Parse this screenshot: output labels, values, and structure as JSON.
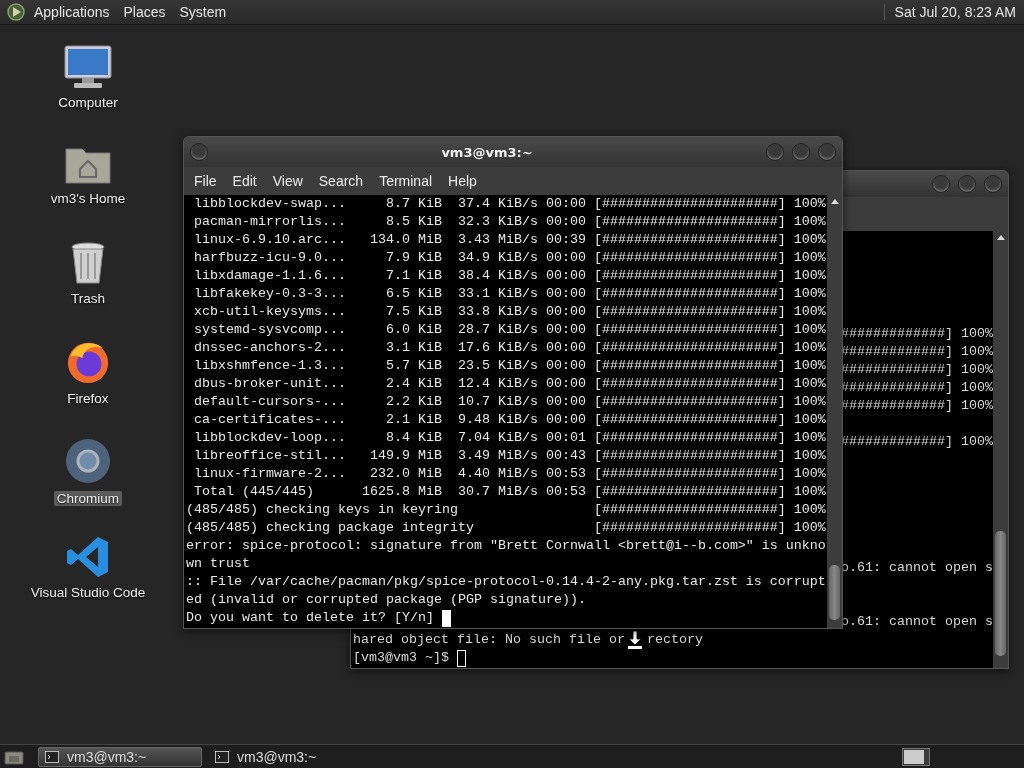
{
  "top_panel": {
    "menus": [
      "Applications",
      "Places",
      "System"
    ],
    "clock": "Sat Jul 20, 8:23 AM"
  },
  "desktop_icons": [
    {
      "kind": "computer",
      "label": "Computer",
      "selected": false
    },
    {
      "kind": "home",
      "label": "vm3's Home",
      "selected": false
    },
    {
      "kind": "trash",
      "label": "Trash",
      "selected": false
    },
    {
      "kind": "firefox",
      "label": "Firefox",
      "selected": false
    },
    {
      "kind": "chromium",
      "label": "Chromium",
      "selected": true
    },
    {
      "kind": "vscode",
      "label": "Visual Studio Code",
      "selected": false
    }
  ],
  "back_terminal": {
    "cursor_filled": false,
    "rows": [
      {
        "kind": "right",
        "text": "#############] 100%"
      },
      {
        "kind": "right",
        "text": "#############] 100%"
      },
      {
        "kind": "right",
        "text": "#############] 100%"
      },
      {
        "kind": "right",
        "text": "#############] 100%"
      },
      {
        "kind": "right",
        "text": "#############] 100%"
      },
      {
        "kind": "gap"
      },
      {
        "kind": "right",
        "text": "#############] 100%"
      },
      {
        "kind": "gap"
      },
      {
        "kind": "gap"
      },
      {
        "kind": "gap"
      },
      {
        "kind": "gap"
      },
      {
        "kind": "gap"
      },
      {
        "kind": "gap"
      },
      {
        "kind": "right",
        "text": "o.61: cannot open s"
      },
      {
        "kind": "gap"
      },
      {
        "kind": "gap"
      },
      {
        "kind": "right",
        "text": "o.61: cannot open s"
      },
      {
        "kind": "covered",
        "text": "hared object file: No such file or",
        "after": "rectory"
      },
      {
        "kind": "prompt",
        "text": "[vm3@vm3 ~]$"
      }
    ]
  },
  "front_terminal": {
    "title": "vm3@vm3:~",
    "menu": [
      "File",
      "Edit",
      "View",
      "Search",
      "Terminal",
      "Help"
    ],
    "cursor_filled": true,
    "lines": [
      {
        "kind": "download",
        "name": "libblockdev-swap...",
        "size": "8.7 KiB",
        "rate": "37.4 KiB/s",
        "time": "00:00",
        "bar": "[######################]",
        "percent": "100%"
      },
      {
        "kind": "download",
        "name": "pacman-mirrorlis...",
        "size": "8.5 KiB",
        "rate": "32.3 KiB/s",
        "time": "00:00",
        "bar": "[######################]",
        "percent": "100%"
      },
      {
        "kind": "download",
        "name": "linux-6.9.10.arc...",
        "size": "134.0 MiB",
        "rate": "3.43 MiB/s",
        "time": "00:39",
        "bar": "[######################]",
        "percent": "100%"
      },
      {
        "kind": "download",
        "name": "harfbuzz-icu-9.0...",
        "size": "7.9 KiB",
        "rate": "34.9 KiB/s",
        "time": "00:00",
        "bar": "[######################]",
        "percent": "100%"
      },
      {
        "kind": "download",
        "name": "libxdamage-1.1.6...",
        "size": "7.1 KiB",
        "rate": "38.4 KiB/s",
        "time": "00:00",
        "bar": "[######################]",
        "percent": "100%"
      },
      {
        "kind": "download",
        "name": "libfakekey-0.3-3...",
        "size": "6.5 KiB",
        "rate": "33.1 KiB/s",
        "time": "00:00",
        "bar": "[######################]",
        "percent": "100%"
      },
      {
        "kind": "download",
        "name": "xcb-util-keysyms...",
        "size": "7.5 KiB",
        "rate": "33.8 KiB/s",
        "time": "00:00",
        "bar": "[######################]",
        "percent": "100%"
      },
      {
        "kind": "download",
        "name": "systemd-sysvcomp...",
        "size": "6.0 KiB",
        "rate": "28.7 KiB/s",
        "time": "00:00",
        "bar": "[######################]",
        "percent": "100%"
      },
      {
        "kind": "download",
        "name": "dnssec-anchors-2...",
        "size": "3.1 KiB",
        "rate": "17.6 KiB/s",
        "time": "00:00",
        "bar": "[######################]",
        "percent": "100%"
      },
      {
        "kind": "download",
        "name": "libxshmfence-1.3...",
        "size": "5.7 KiB",
        "rate": "23.5 KiB/s",
        "time": "00:00",
        "bar": "[######################]",
        "percent": "100%"
      },
      {
        "kind": "download",
        "name": "dbus-broker-unit...",
        "size": "2.4 KiB",
        "rate": "12.4 KiB/s",
        "time": "00:00",
        "bar": "[######################]",
        "percent": "100%"
      },
      {
        "kind": "download",
        "name": "default-cursors-...",
        "size": "2.2 KiB",
        "rate": "10.7 KiB/s",
        "time": "00:00",
        "bar": "[######################]",
        "percent": "100%"
      },
      {
        "kind": "download",
        "name": "ca-certificates-...",
        "size": "2.1 KiB",
        "rate": "9.48 KiB/s",
        "time": "00:00",
        "bar": "[######################]",
        "percent": "100%"
      },
      {
        "kind": "download",
        "name": "libblockdev-loop...",
        "size": "8.4 KiB",
        "rate": "7.04 KiB/s",
        "time": "00:01",
        "bar": "[######################]",
        "percent": "100%"
      },
      {
        "kind": "download",
        "name": "libreoffice-stil...",
        "size": "149.9 MiB",
        "rate": "3.49 MiB/s",
        "time": "00:43",
        "bar": "[######################]",
        "percent": "100%"
      },
      {
        "kind": "download",
        "name": "linux-firmware-2...",
        "size": "232.0 MiB",
        "rate": "4.40 MiB/s",
        "time": "00:53",
        "bar": "[######################]",
        "percent": "100%"
      },
      {
        "kind": "download",
        "name": "Total (445/445)",
        "size": "1625.8 MiB",
        "rate": "30.7 MiB/s",
        "time": "00:53",
        "bar": "[######################]",
        "percent": "100%"
      },
      {
        "kind": "check",
        "text": "(485/485) checking keys in keyring",
        "bar": "[######################]",
        "percent": "100%"
      },
      {
        "kind": "check",
        "text": "(485/485) checking package integrity",
        "bar": "[######################]",
        "percent": "100%"
      },
      {
        "kind": "text",
        "text": "error: spice-protocol: signature from \"Brett Cornwall <brett@i--b.com>\" is unkno"
      },
      {
        "kind": "text",
        "text": "wn trust"
      },
      {
        "kind": "text",
        "text": ":: File /var/cache/pacman/pkg/spice-protocol-0.14.4-2-any.pkg.tar.zst is corrupt"
      },
      {
        "kind": "text",
        "text": "ed (invalid or corrupted package (PGP signature))."
      },
      {
        "kind": "prompt",
        "text": "Do you want to delete it? [Y/n]"
      }
    ]
  },
  "taskbar": {
    "tasks": [
      {
        "label": "vm3@vm3:~",
        "selected": true
      },
      {
        "label": "vm3@vm3:~",
        "selected": false
      }
    ]
  }
}
